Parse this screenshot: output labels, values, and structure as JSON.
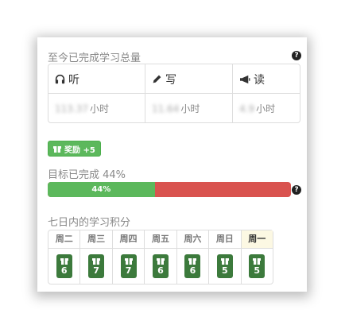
{
  "totals": {
    "title": "至今已完成学习总量",
    "columns": [
      {
        "icon": "headphones-icon",
        "label": "听",
        "value": "113.37",
        "unit": "小时"
      },
      {
        "icon": "pencil-icon",
        "label": "写",
        "value": "11.64",
        "unit": "小时"
      },
      {
        "icon": "megaphone-icon",
        "label": "读",
        "value": "4.9",
        "unit": "小时"
      }
    ]
  },
  "reward": {
    "label": "奖励 +5",
    "icon": "gift-icon"
  },
  "goal": {
    "title": "目标已完成 44%",
    "percent": 44,
    "bar_label": "44%",
    "colors": {
      "done": "#5cb85c",
      "remaining": "#d9534f"
    }
  },
  "weekly": {
    "title": "七日内的学习积分",
    "days": [
      {
        "name": "周二",
        "points": "6"
      },
      {
        "name": "周三",
        "points": "7"
      },
      {
        "name": "周四",
        "points": "7"
      },
      {
        "name": "周五",
        "points": "6"
      },
      {
        "name": "周六",
        "points": "6"
      },
      {
        "name": "周日",
        "points": "5"
      },
      {
        "name": "周一",
        "points": "5",
        "today": true
      }
    ],
    "highlight_color": "#fcf8e3"
  },
  "help_glyph": "?"
}
